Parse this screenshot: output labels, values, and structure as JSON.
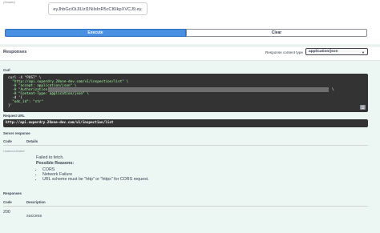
{
  "header": {
    "param_label": "(header)",
    "token_value": "eyJhbGciOiJIUzI1NiIsInR5cCI6IkpXVCJ9.ey."
  },
  "buttons": {
    "execute": "Execute",
    "clear": "Clear"
  },
  "responses": {
    "title": "Responses",
    "content_type_label": "Response content type",
    "content_type_value": "application/json"
  },
  "curl": {
    "heading": "Curl",
    "lines": [
      "curl -X \"POST\" \\",
      "  \"http://api.superdry.28one-dev.com/v1/inspection/list\" \\",
      "  -H \"accept: application/json\" \\",
      "  -H \"Authorization: eyJhbGciOi",
      "  -H \"Content-Type: application/json\" \\",
      "  -d '{",
      "  \"odc_id\": \"str\"",
      "}'"
    ]
  },
  "request_url": {
    "heading": "Request URL",
    "value": "http://api.superdry.28one-dev.com/v1/inspection/list"
  },
  "server_response": {
    "heading": "Server response",
    "col_code": "Code",
    "col_details": "Details",
    "code": "Undocumented",
    "failed": "Failed to fetch.",
    "possible": "Possible Reasons:",
    "reasons": [
      "CORS",
      "Network Failure",
      "URL scheme must be \"http\" or \"https\" for CORS request."
    ]
  },
  "documented": {
    "heading": "Responses",
    "col_code": "Code",
    "col_description": "Description",
    "code": "200",
    "description": "success"
  },
  "icons": {
    "copy": "copy-icon",
    "caret": "chevron-down-icon"
  }
}
